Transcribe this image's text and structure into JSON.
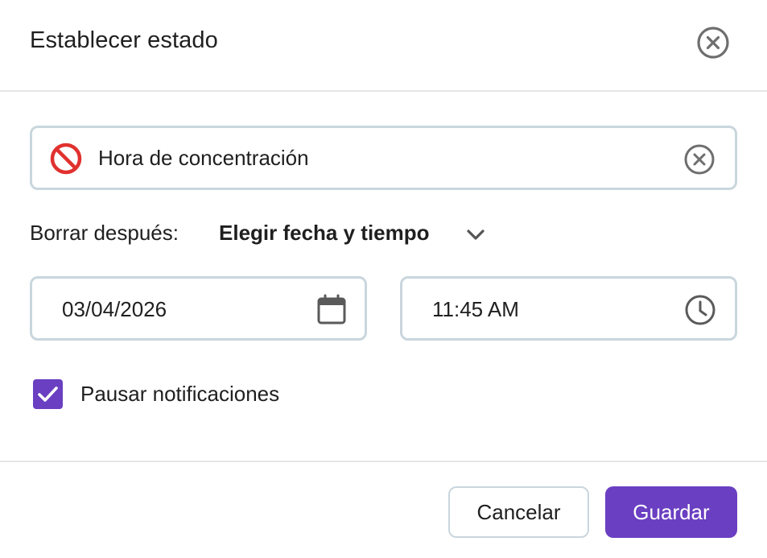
{
  "dialog": {
    "title": "Establecer estado",
    "close_icon": "close-circle-icon"
  },
  "status": {
    "emoji": "no-entry-emoji",
    "text": "Hora de concentración",
    "clear_icon": "clear-circle-icon"
  },
  "clear_after": {
    "label": "Borrar después:",
    "selected": "Elegir fecha y tiempo",
    "chevron_icon": "chevron-down-icon"
  },
  "date": {
    "value": "03/04/2026",
    "icon": "calendar-icon"
  },
  "time": {
    "value": "11:45 AM",
    "icon": "clock-icon"
  },
  "pause_notifications": {
    "label": "Pausar notificaciones",
    "checked": true
  },
  "footer": {
    "cancel_label": "Cancelar",
    "save_label": "Guardar"
  },
  "colors": {
    "accent": "#6a3fc1",
    "border": "#c9d6dd",
    "emoji_red": "#e0312f"
  }
}
